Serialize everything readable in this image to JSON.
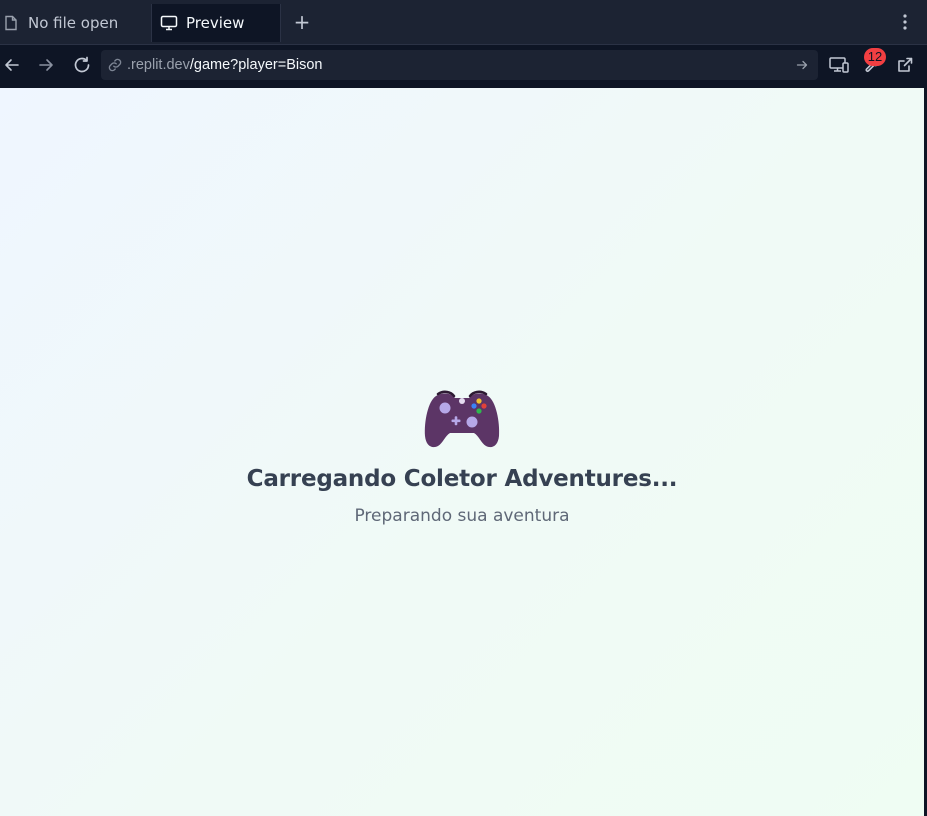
{
  "tabs": [
    {
      "label": "No file open",
      "icon": "file-icon",
      "active": false
    },
    {
      "label": "Preview",
      "icon": "monitor-icon",
      "active": true
    }
  ],
  "tabbar": {
    "add_label": "+"
  },
  "address": {
    "host": ".replit.dev",
    "path": "/game?player=Bison"
  },
  "devtools": {
    "badge_count": "12"
  },
  "loading": {
    "icon": "game-controller-icon",
    "title": "Carregando Coletor Adventures...",
    "subtitle": "Preparando sua aventura"
  },
  "colors": {
    "chrome_bg": "#0e1525",
    "tab_bg": "#1c2333",
    "badge": "#f23f42",
    "controller": "#5c3566",
    "title_text": "#364152",
    "subtitle_text": "#5f6877"
  }
}
